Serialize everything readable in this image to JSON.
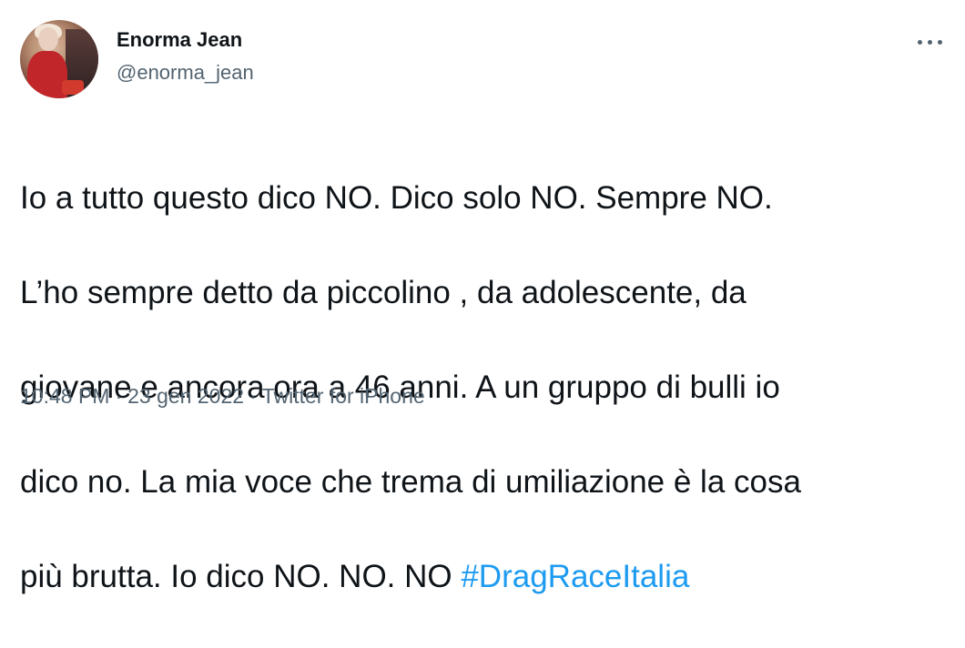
{
  "author": {
    "display_name": "Enorma Jean",
    "handle": "@enorma_jean"
  },
  "tweet": {
    "text_lines": [
      "Io a tutto questo dico NO. Dico solo NO. Sempre NO.",
      "L’ho sempre detto da piccolino , da adolescente, da",
      "giovane e ancora ora a 46 anni. A un gruppo di bulli io",
      "dico no. La mia voce che trema di umiliazione è la cosa"
    ],
    "last_line_text": "più brutta. Io dico NO. NO. NO ",
    "hashtag": "#DragRaceItalia"
  },
  "meta": {
    "time": "10:48 PM",
    "separator": "·",
    "date": "23 gen 2022",
    "source": "Twitter for iPhone"
  },
  "icons": {
    "more": "more-horizontal-icon",
    "avatar": "profile-avatar"
  },
  "colors": {
    "text": "#0f1419",
    "secondary": "#536471",
    "link": "#1d9bf0"
  }
}
